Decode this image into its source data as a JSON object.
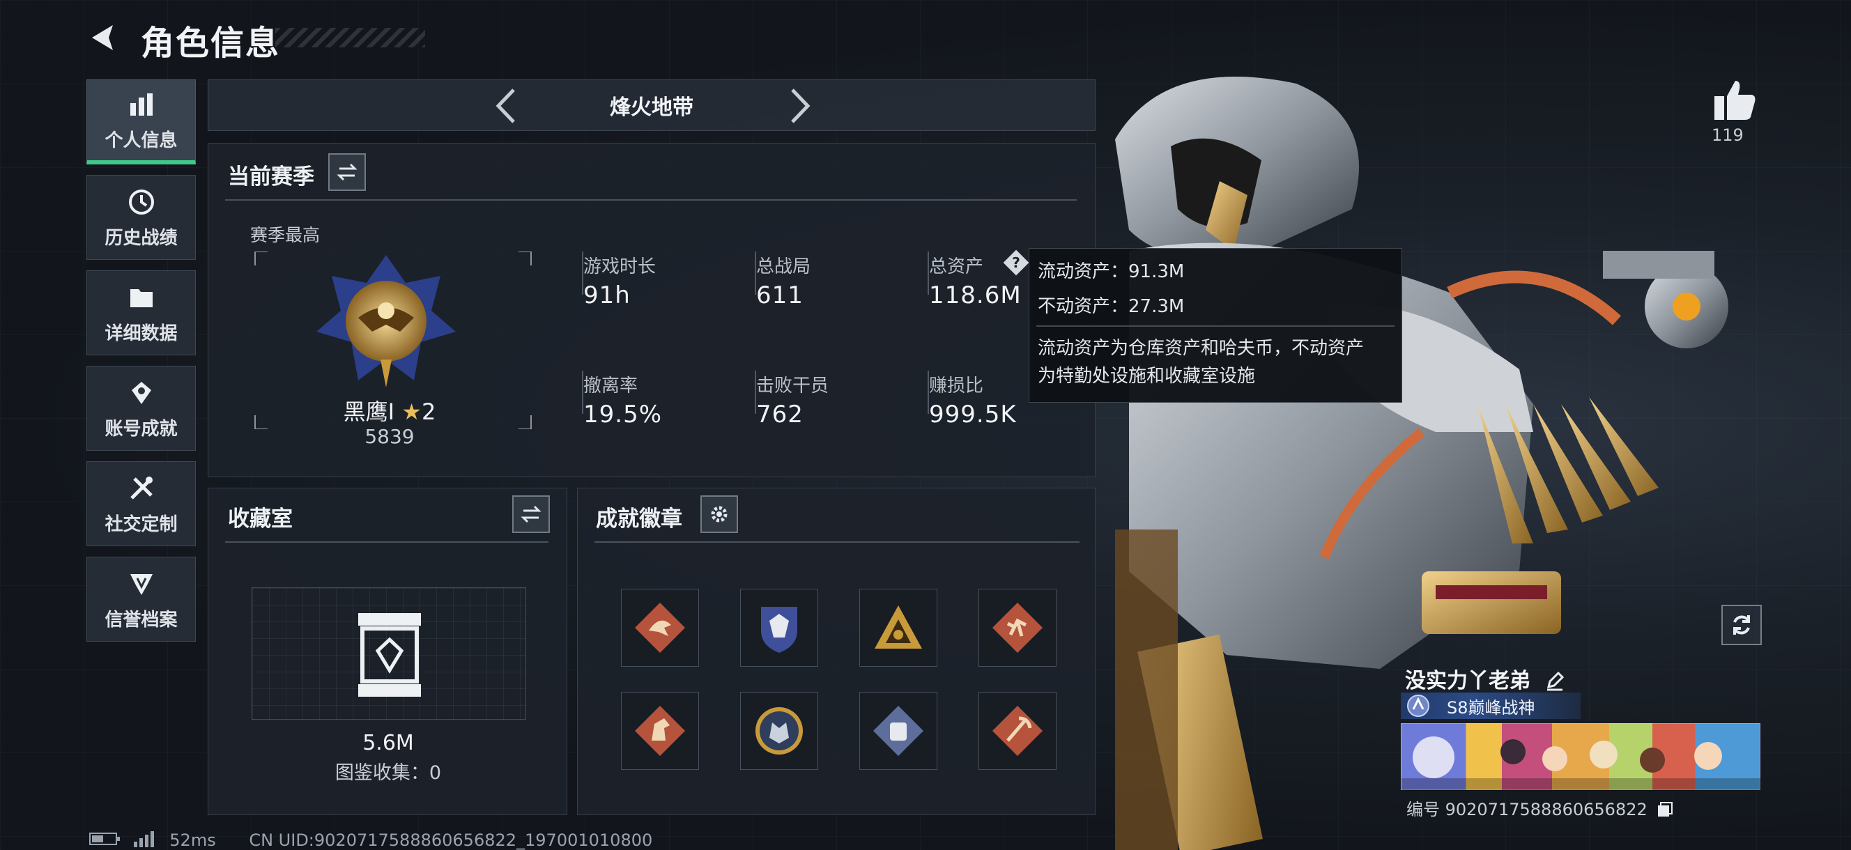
{
  "header": {
    "title": "角色信息",
    "back_icon": "back-arrow-icon"
  },
  "sidebar": {
    "items": [
      {
        "label": "个人信息",
        "icon": "bar-chart-icon",
        "active": true
      },
      {
        "label": "历史战绩",
        "icon": "clock-history-icon",
        "active": false
      },
      {
        "label": "详细数据",
        "icon": "folder-icon",
        "active": false
      },
      {
        "label": "账号成就",
        "icon": "medal-icon",
        "active": false
      },
      {
        "label": "社交定制",
        "icon": "tools-icon",
        "active": false
      },
      {
        "label": "信誉档案",
        "icon": "shield-emblem-icon",
        "active": false
      }
    ]
  },
  "mode": {
    "name": "烽火地带"
  },
  "season": {
    "title": "当前赛季",
    "highest_label": "赛季最高",
    "rank_name": "黑鹰I",
    "rank_stars": "2",
    "rank_score": "5839",
    "stats": [
      {
        "label": "游戏时长",
        "value": "91h"
      },
      {
        "label": "总战局",
        "value": "611"
      },
      {
        "label": "总资产",
        "value": "118.6M"
      },
      {
        "label": "撤离率",
        "value": "19.5%"
      },
      {
        "label": "击败干员",
        "value": "762"
      },
      {
        "label": "赚损比",
        "value": "999.5K"
      }
    ]
  },
  "tooltip": {
    "liquid": "流动资产：91.3M",
    "fixed": "不动资产：27.3M",
    "desc_line1": "流动资产为仓库资产和哈夫币，不动资产",
    "desc_line2": "为特勤处设施和收藏室设施"
  },
  "collection": {
    "title": "收藏室",
    "value": "5.6M",
    "catalog": "图鉴收集：0"
  },
  "achievements": {
    "title": "成就徽章",
    "badges": [
      {
        "icon": "dragon-badge-icon",
        "color": "#b5533c"
      },
      {
        "icon": "wolf-shield-badge-icon",
        "color": "#3f4f9a"
      },
      {
        "icon": "triangle-badge-icon",
        "color": "#c99a3a"
      },
      {
        "icon": "runner-badge-icon",
        "color": "#b5533c"
      },
      {
        "icon": "horse-badge-icon",
        "color": "#b5533c"
      },
      {
        "icon": "wolf-coin-badge-icon",
        "color": "#7c8fa8"
      },
      {
        "icon": "fist-badge-icon",
        "color": "#5d6e9c"
      },
      {
        "icon": "pick-badge-icon",
        "color": "#b5533c"
      }
    ]
  },
  "profile": {
    "likes": "119",
    "name": "没实力丫老弟",
    "rank_tag": "S8巅峰战神",
    "id_line": "编号 9020717588860656822"
  },
  "footer": {
    "ping": "52ms",
    "uid": "CN UID:9020717588860656822_197001010800"
  },
  "colors": {
    "accent": "#3ec98b",
    "gold": "#c99a3a"
  }
}
